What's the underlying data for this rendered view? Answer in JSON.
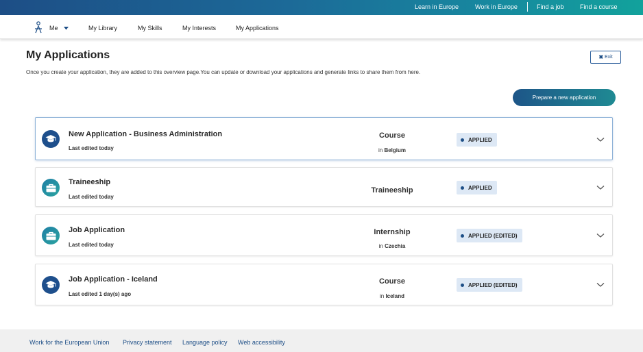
{
  "topbar": {
    "links": [
      "Learn in Europe",
      "Work in Europe",
      "Find a job",
      "Find a course"
    ]
  },
  "nav": {
    "me_label": "Me",
    "items": [
      "My Library",
      "My Skills",
      "My Interests",
      "My Applications"
    ]
  },
  "page": {
    "title": "My Applications",
    "description": "Once you create your application, they are added to this overview page.You can update or download your applications and generate links to share them from here.",
    "exit_label": "Exit",
    "new_application_label": "Prepare a new application"
  },
  "applications": [
    {
      "title": "New Application - Business Administration",
      "edited": "Last edited today",
      "type": "Course",
      "location_prefix": "in",
      "location": "Belgium",
      "status": "APPLIED",
      "icon": "graduation-cap-icon"
    },
    {
      "title": "Traineeship",
      "edited": "Last edited today",
      "type": "Traineeship",
      "location_prefix": "",
      "location": "",
      "status": "APPLIED",
      "icon": "briefcase-icon"
    },
    {
      "title": "Job Application",
      "edited": "Last edited today",
      "type": "Internship",
      "location_prefix": "in",
      "location": "Czechia",
      "status": "APPLIED (EDITED)",
      "icon": "briefcase-icon"
    },
    {
      "title": "Job Application - Iceland",
      "edited": "Last edited 1 day(s) ago",
      "type": "Course",
      "location_prefix": "in",
      "location": "Iceland",
      "status": "APPLIED (EDITED)",
      "icon": "graduation-cap-icon"
    }
  ],
  "footer": {
    "links": [
      "Work for the European Union",
      "Privacy statement",
      "Language policy",
      "Web accessibility"
    ]
  },
  "colors": {
    "brand_dark": "#1d4e86",
    "brand_teal": "#12a29c",
    "badge_bg": "#dde8f5"
  }
}
